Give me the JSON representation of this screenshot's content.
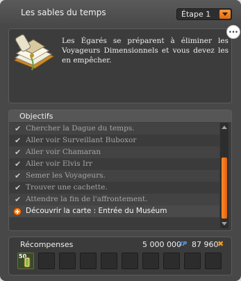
{
  "window": {
    "title": "Les sables du temps",
    "stage_label": "Étape 1",
    "more_button": "..."
  },
  "description": {
    "text": "Les Égarés se préparent à éliminer les Voyageurs Dimensionnels et vous devez les en empêcher.",
    "icon": "book-scroll-icon"
  },
  "objectives": {
    "header": "Objectifs",
    "items": [
      {
        "label": "Chercher la Dague du temps.",
        "done": true
      },
      {
        "label": "Aller voir Surveillant Buboxor",
        "done": true
      },
      {
        "label": "Aller voir Chamaran",
        "done": true
      },
      {
        "label": "Aller voir Elvis Irr",
        "done": true
      },
      {
        "label": "Semer les Voyageurs.",
        "done": true
      },
      {
        "label": "Trouver une cachette.",
        "done": true
      },
      {
        "label": "Attendre la fin de l'affrontement.",
        "done": true
      },
      {
        "label": "Découvrir la carte : Entrée du Muséum",
        "done": false
      }
    ],
    "check_glyph": "✔"
  },
  "rewards": {
    "label": "Récompenses",
    "xp": "5 000 000",
    "xp_icon": "XP",
    "kamas": "87 960",
    "kamas_icon": "✖",
    "item": {
      "quantity": "50",
      "icon": "scroll-item-icon"
    },
    "empty_slots": 10
  },
  "colors": {
    "accent": "#f07a1a",
    "panel": "#3b3b3b",
    "window": "#484848"
  }
}
